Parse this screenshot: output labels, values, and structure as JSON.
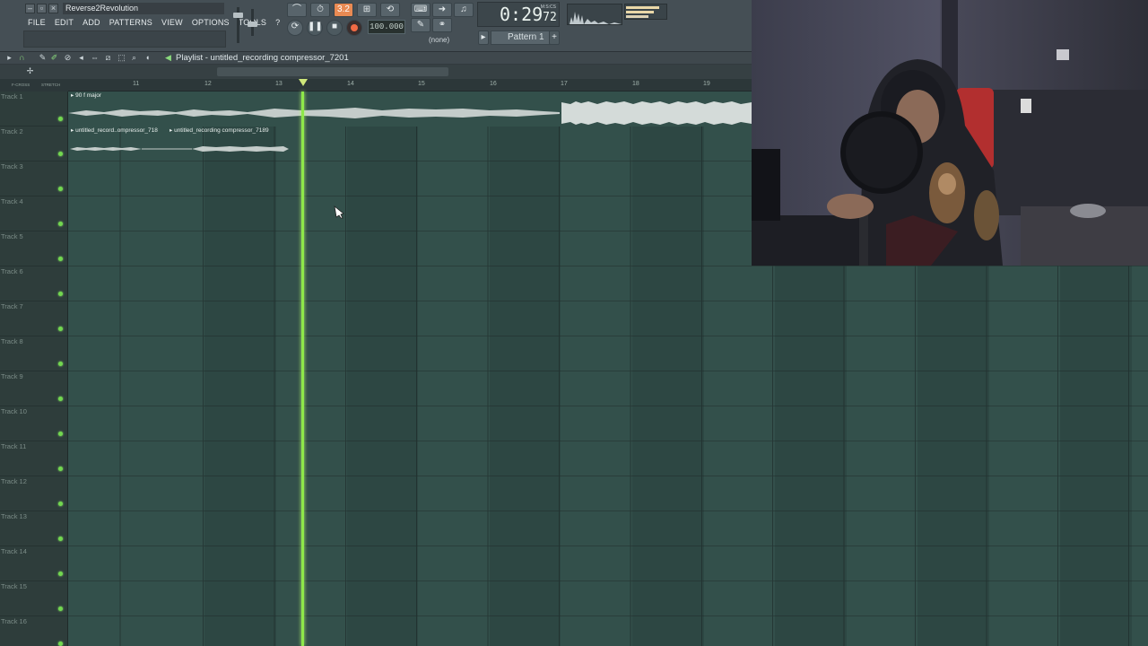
{
  "window": {
    "title": "Reverse2Revolution"
  },
  "menu": [
    "FILE",
    "EDIT",
    "ADD",
    "PATTERNS",
    "VIEW",
    "OPTIONS",
    "TOOLS",
    "?"
  ],
  "transport": {
    "tempo": "100.000",
    "time_main": "0:29",
    "time_sub": "72",
    "time_unit": "M:S:CS",
    "pattern": "Pattern 1",
    "mode_label": "(none)"
  },
  "playlist": {
    "title": "Playlist - untitled_recording compressor_7201",
    "ruler_left_labels": [
      "F-CROSS",
      "STRETCH"
    ],
    "bar_numbers": [
      "11",
      "12",
      "13",
      "14",
      "15",
      "16",
      "17",
      "18",
      "19"
    ],
    "tracks": [
      "Track 1",
      "Track 2",
      "Track 3",
      "Track 4",
      "Track 5",
      "Track 6",
      "Track 7",
      "Track 8",
      "Track 9",
      "Track 10",
      "Track 11",
      "Track 12",
      "Track 13",
      "Track 14",
      "Track 15",
      "Track 16"
    ],
    "clips": {
      "track1_label": "90 f major",
      "track2_label_a": "untitled_record..ompressor_718",
      "track2_label_b": "untitled_recording compressor_7189"
    }
  },
  "colors": {
    "grid_bg": "#33504b",
    "playhead": "#8ee84a",
    "record_accent": "#e98a53",
    "led": "#72d84f"
  }
}
